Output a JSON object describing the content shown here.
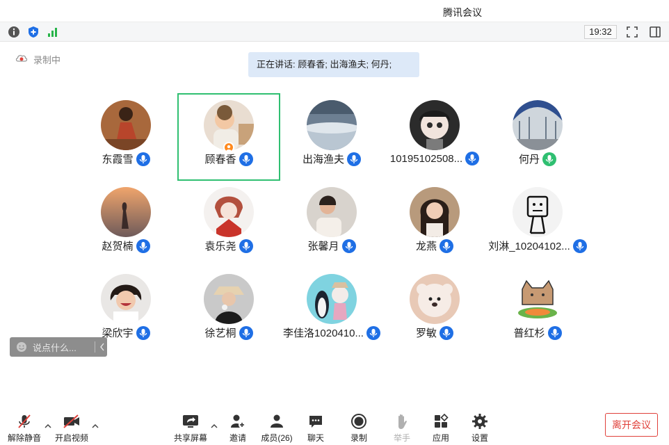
{
  "window": {
    "title": "腾讯会议"
  },
  "toolbar": {
    "time": "19:32"
  },
  "status": {
    "recording_label": "录制中",
    "speaking_text": "正在讲话: 顾春香; 出海渔夫; 何丹;"
  },
  "colors": {
    "accent": "#1f6fe5",
    "active_border": "#2fbf71",
    "leave": "#e0403a",
    "host_badge": "#ff8a1f"
  },
  "participants": [
    {
      "name": "东霞雪",
      "mic": "active-blue"
    },
    {
      "name": "顾春香",
      "mic": "active-blue",
      "host": true,
      "active": true
    },
    {
      "name": "出海渔夫",
      "mic": "active-blue"
    },
    {
      "name": "10195102508...",
      "mic": "active-blue"
    },
    {
      "name": "何丹",
      "mic": "speaking-green"
    },
    {
      "name": "赵贺楠",
      "mic": "active-blue"
    },
    {
      "name": "袁乐尧",
      "mic": "active-blue"
    },
    {
      "name": "张馨月",
      "mic": "active-blue"
    },
    {
      "name": "龙燕",
      "mic": "active-blue"
    },
    {
      "name": "刘淋_10204102...",
      "mic": "active-blue"
    },
    {
      "name": "梁欣宇",
      "mic": "active-blue"
    },
    {
      "name": "徐艺桐",
      "mic": "active-blue"
    },
    {
      "name": "李佳洛1020410...",
      "mic": "active-blue"
    },
    {
      "name": "罗敏",
      "mic": "active-blue"
    },
    {
      "name": "普红杉",
      "mic": "active-blue"
    }
  ],
  "chat": {
    "placeholder": "说点什么..."
  },
  "bottom": {
    "unmute": "解除静音",
    "video": "开启视频",
    "share": "共享屏幕",
    "invite": "邀请",
    "members": "成员(26)",
    "chat": "聊天",
    "record": "录制",
    "raise_hand": "举手",
    "apps": "应用",
    "settings": "设置",
    "leave": "离开会议"
  }
}
